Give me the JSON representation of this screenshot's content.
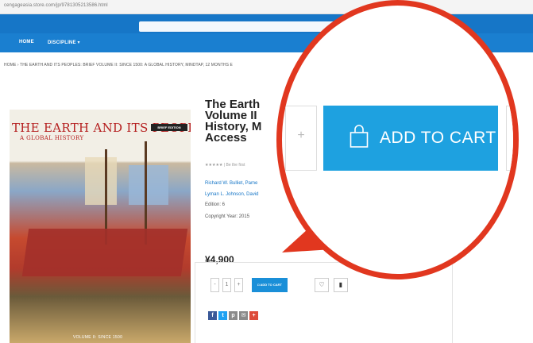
{
  "browser": {
    "url": "cengageasia.store.com/jp/9781305213586.html"
  },
  "nav": {
    "home": "HOME",
    "discipline": "DISCIPLINE"
  },
  "breadcrumb": "HOME  ›  THE EARTH AND ITS PEOPLES: BRIEF VOLUME II: SINCE 1500: A GLOBAL HISTORY, MINDTAP, 12 MONTHS E",
  "cover": {
    "title": "THE EARTH AND ITS PEOPLES",
    "subtitle": "A GLOBAL HISTORY",
    "badge": "BRIEF EDITION",
    "foot": "VOLUME II: SINCE 1500"
  },
  "product": {
    "title": "The Earth Volume II History, M Access",
    "rating": "★★★★★  |  Be the first",
    "authors_line1": "Richard W. Bulliet, Pame",
    "authors_line2": "Lyman L. Johnson, David",
    "edition": "Edition: 6",
    "copyright": "Copyright Year: 2015",
    "price": "¥4,900",
    "isbn_fragment": "97813052",
    "qty": {
      "minus": "-",
      "value": "1",
      "plus": "+"
    },
    "cart_label_small": "ADD TO CART"
  },
  "share_buttons": [
    {
      "label": "f",
      "color": "#3b5998"
    },
    {
      "label": "t",
      "color": "#1da1f2"
    },
    {
      "label": "p",
      "color": "#8a8a8a"
    },
    {
      "label": "✉",
      "color": "#8a8a8a"
    },
    {
      "label": "+",
      "color": "#dd4b39"
    }
  ],
  "callout": {
    "cart_label": "ADD TO CART",
    "accent": "#e1371f",
    "button_color": "#1ea1e0"
  }
}
